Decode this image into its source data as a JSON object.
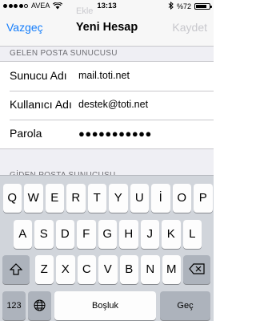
{
  "status_bar": {
    "carrier": "AVEA",
    "time": "13:13",
    "battery_text": "%72",
    "battery_level": 0.72,
    "signal_bars_filled": 4,
    "signal_bars_total": 5
  },
  "nav": {
    "ghost_title": "Ekle",
    "cancel_label": "Vazgeç",
    "title": "Yeni Hesap",
    "save_label": "Kaydet"
  },
  "incoming_section": {
    "header": "GELEN POSTA SUNUCUSU",
    "fields": [
      {
        "label": "Sunucu Adı",
        "value": "mail.toti.net"
      },
      {
        "label": "Kullanıcı Adı",
        "value": "destek@toti.net"
      },
      {
        "label": "Parola",
        "value": "●●●●●●●●●●●"
      }
    ]
  },
  "outgoing_section": {
    "header": "GİDEN POSTA SUNUCUSU"
  },
  "keyboard": {
    "row1": [
      "Q",
      "W",
      "E",
      "R",
      "T",
      "Y",
      "U",
      "İ",
      "O",
      "P"
    ],
    "row2": [
      "A",
      "S",
      "D",
      "F",
      "G",
      "H",
      "J",
      "K",
      "L"
    ],
    "row3": [
      "Z",
      "X",
      "C",
      "V",
      "B",
      "N",
      "M"
    ],
    "numbers_label": "123",
    "space_label": "Boşluk",
    "return_label": "Geç"
  },
  "colors": {
    "accent": "#157efb",
    "disabled": "#c7c7cc",
    "group_background": "#efeff4",
    "keyboard_background": "#d1d5db"
  },
  "icons": {
    "shift": "shift-icon",
    "backspace": "backspace-icon",
    "globe": "globe-icon",
    "wifi": "wifi-icon",
    "bluetooth": "bluetooth-icon"
  }
}
